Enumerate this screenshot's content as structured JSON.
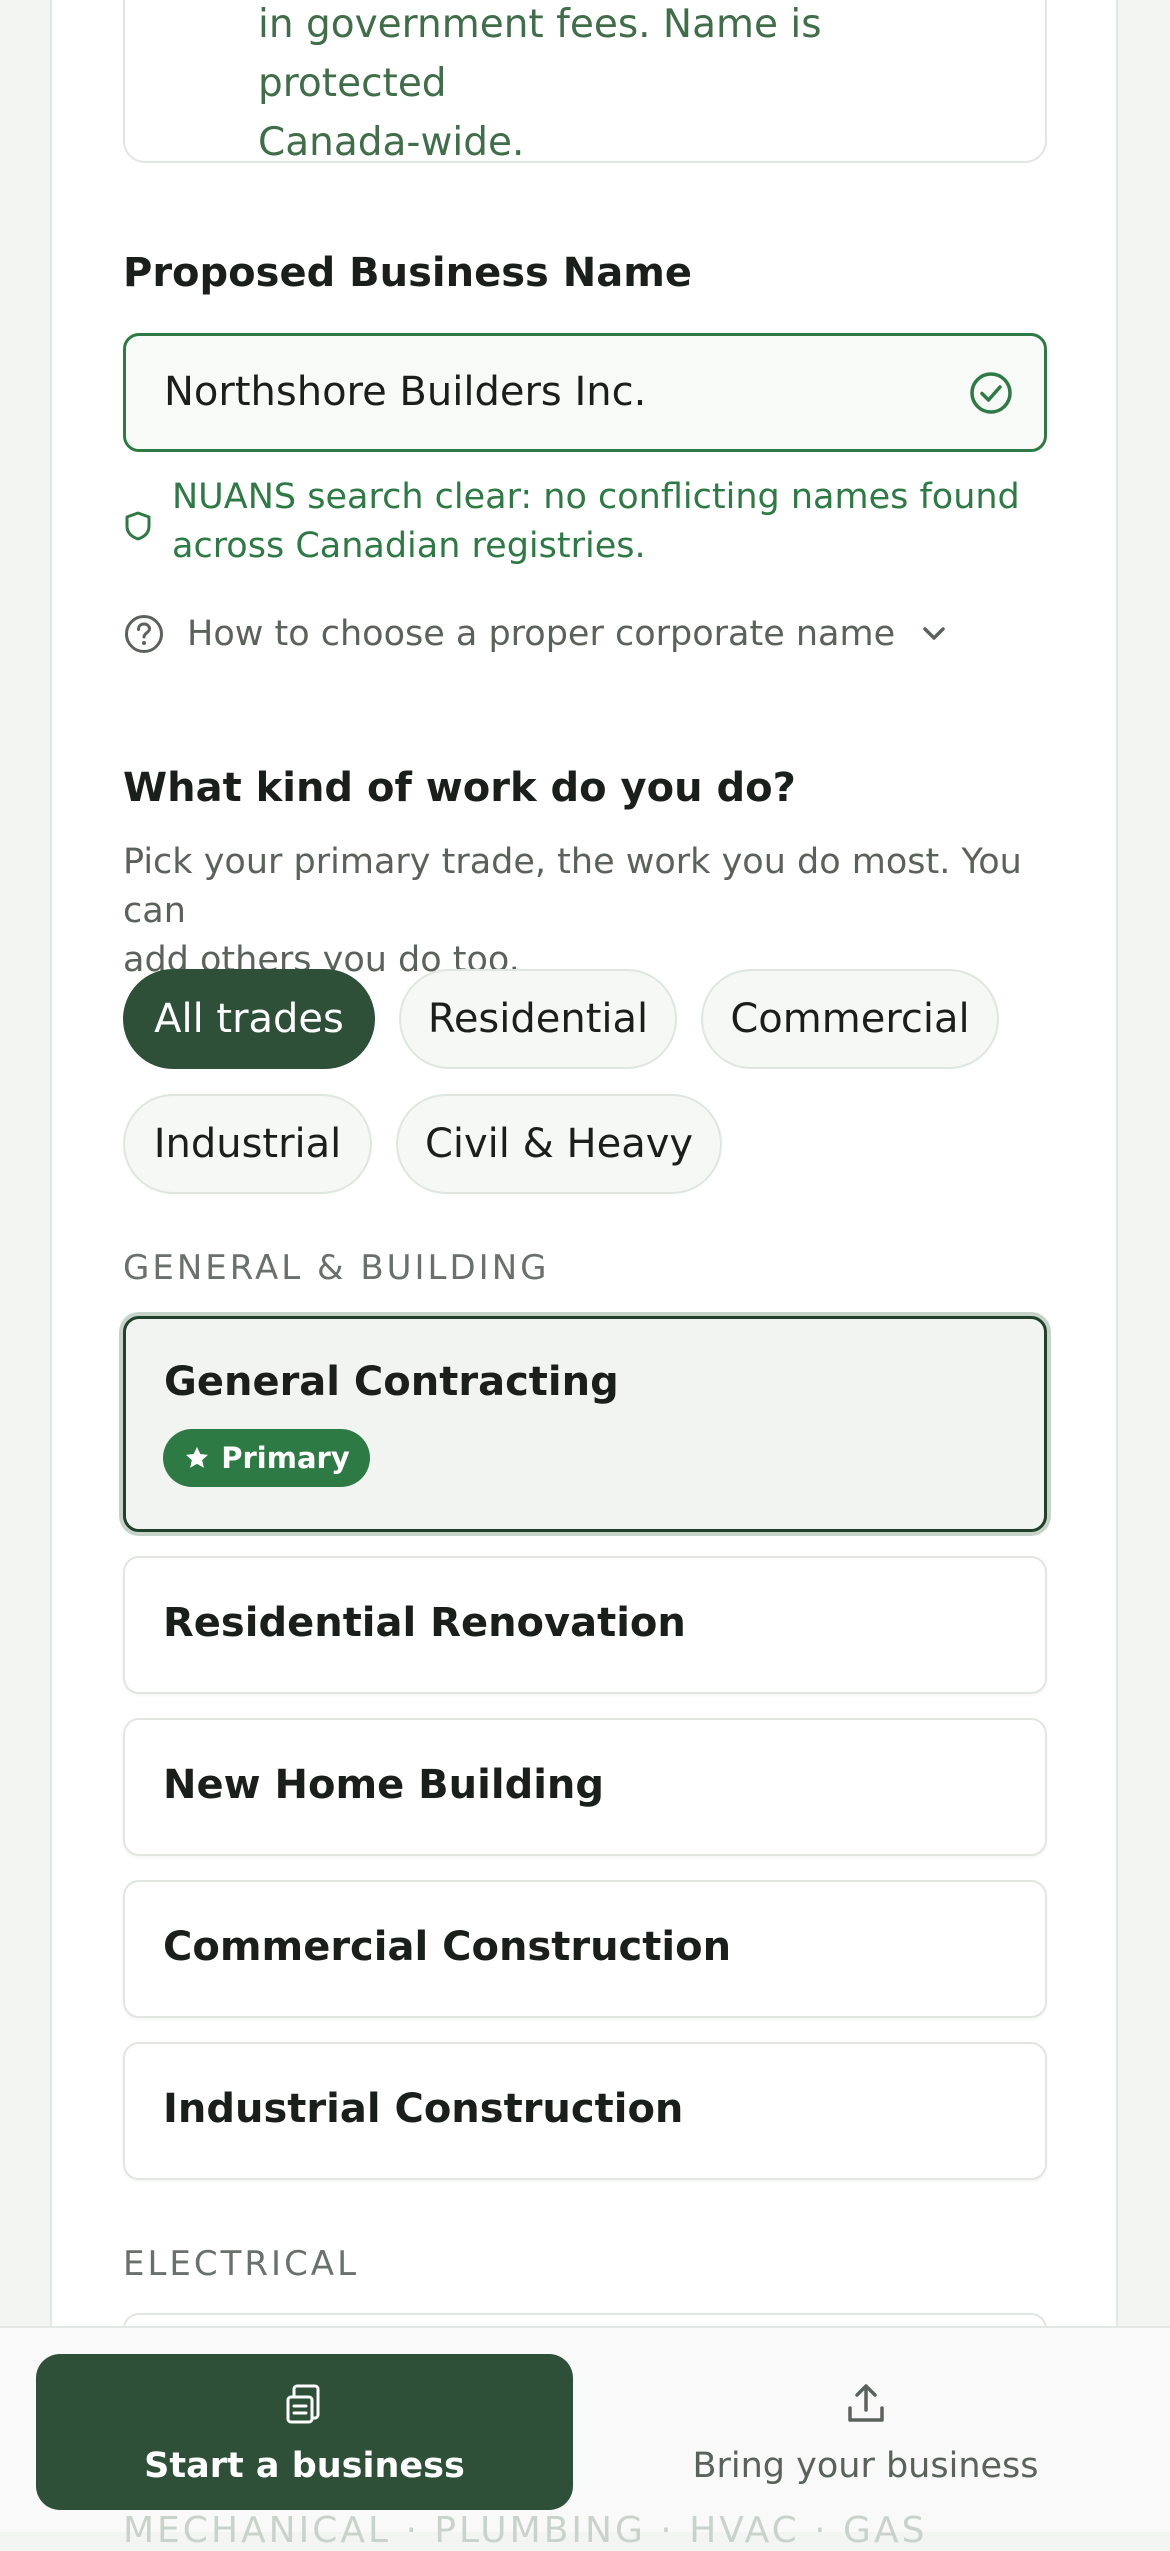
{
  "info_card": {
    "text_line1": "in government fees. Name is protected",
    "text_line2": "Canada-wide."
  },
  "business_name": {
    "label": "Proposed Business Name",
    "value": "Northshore Builders Inc.",
    "status_icon": "check-circle-icon",
    "nuans_line1": "NUANS search clear: no conflicting names found",
    "nuans_line2": "across Canadian registries.",
    "howto_label": "How to choose a proper corporate name"
  },
  "trade_section": {
    "title": "What kind of work do you do?",
    "subtitle_line1": "Pick your primary trade, the work you do most. You can",
    "subtitle_line2": "add others you do too.",
    "filters": [
      {
        "label": "All trades",
        "active": true
      },
      {
        "label": "Residential",
        "active": false
      },
      {
        "label": "Commercial",
        "active": false
      },
      {
        "label": "Industrial",
        "active": false
      },
      {
        "label": "Civil & Heavy",
        "active": false
      }
    ],
    "groups": [
      {
        "label": "GENERAL & BUILDING",
        "items": [
          {
            "name": "General Contracting",
            "primary": true,
            "badge": "Primary"
          },
          {
            "name": "Residential Renovation"
          },
          {
            "name": "New Home Building"
          },
          {
            "name": "Commercial Construction"
          },
          {
            "name": "Industrial Construction"
          }
        ]
      },
      {
        "label": "ELECTRICAL",
        "items": []
      }
    ],
    "next_group_hint": "MECHANICAL · PLUMBING · HVAC · GAS"
  },
  "bottom_nav": {
    "start_label": "Start a business",
    "bring_label": "Bring your business"
  },
  "colors": {
    "brand_dark": "#2e5039",
    "accent_green": "#2e7a44",
    "muted_text": "#5b625c"
  }
}
